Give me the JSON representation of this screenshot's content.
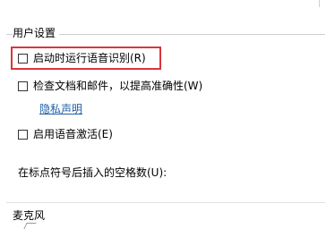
{
  "user_settings": {
    "title": "用户设置",
    "startup_option": "启动时运行语音识别(R)",
    "review_option": "检查文档和邮件，以提高准确性(W)",
    "privacy_link": "隐私声明",
    "voice_activation_option": "启用语音激活(E)",
    "spaces_label": "在标点符号后插入的空格数(U):"
  },
  "microphone": {
    "title": "麦克风"
  },
  "colors": {
    "highlight": "#d9363e",
    "link": "#1f5ea8"
  }
}
